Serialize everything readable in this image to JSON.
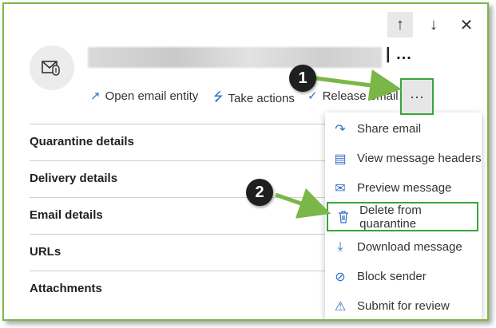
{
  "header": {
    "nav_up_icon": "arrow-up-icon",
    "nav_down_icon": "arrow-down-icon",
    "close_icon": "close-icon",
    "subject_more": "| ..."
  },
  "actions": [
    {
      "label": "Open email entity",
      "icon": "open-external-icon"
    },
    {
      "label": "Take actions",
      "icon": "lightning-icon"
    },
    {
      "label": "Release email",
      "icon": "checkmark-icon"
    }
  ],
  "more_button": "···",
  "sections": [
    "Quarantine details",
    "Delivery details",
    "Email details",
    "URLs",
    "Attachments"
  ],
  "menu": [
    {
      "label": "Share email",
      "icon": "share-icon"
    },
    {
      "label": "View message headers",
      "icon": "message-header-icon"
    },
    {
      "label": "Preview message",
      "icon": "envelope-open-icon"
    },
    {
      "label": "Delete from quarantine",
      "icon": "trash-icon"
    },
    {
      "label": "Download message",
      "icon": "download-icon"
    },
    {
      "label": "Block sender",
      "icon": "block-person-icon"
    },
    {
      "label": "Submit for review",
      "icon": "submit-review-icon"
    }
  ],
  "callouts": [
    "1",
    "2"
  ],
  "colors": {
    "highlight": "#3aa53a",
    "accent": "#2f6fc2",
    "arrow": "#7ab648"
  }
}
